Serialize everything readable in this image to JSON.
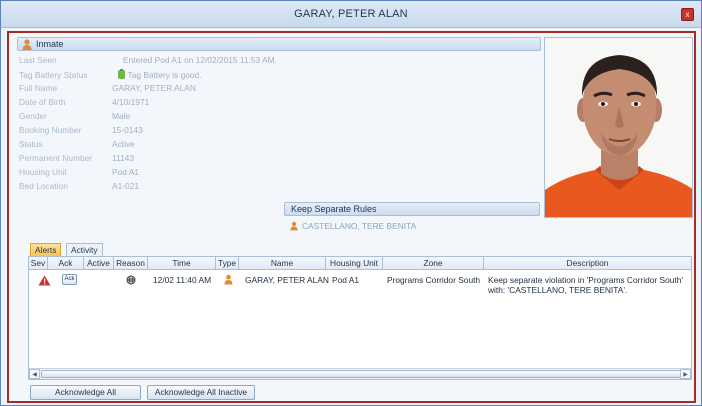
{
  "window": {
    "title": "GARAY, PETER ALAN",
    "close_glyph": "x"
  },
  "inmate": {
    "header": "Inmate",
    "fields": [
      {
        "label": "Last Seen",
        "value": "Entered Pod A1 on 12/02/2015 11:53 AM."
      },
      {
        "label": "Tag Battery Status",
        "value": "Tag Battery is good."
      },
      {
        "label": "Full Name",
        "value": "GARAY, PETER ALAN"
      },
      {
        "label": "Date of Birth",
        "value": "4/10/1971"
      },
      {
        "label": "Gender",
        "value": "Male"
      },
      {
        "label": "Booking Number",
        "value": "15-0143"
      },
      {
        "label": "Status",
        "value": "Active"
      },
      {
        "label": "Permanent Number",
        "value": "11143"
      },
      {
        "label": "Housing Unit",
        "value": "Pod A1"
      },
      {
        "label": "Bed Location",
        "value": "A1-021"
      }
    ]
  },
  "keep_separate": {
    "header": "Keep Separate Rules",
    "entry": "CASTELLANO, TERE BENITA"
  },
  "tabs": [
    {
      "label": "Alerts",
      "active": true
    },
    {
      "label": "Activity",
      "active": false
    }
  ],
  "grid": {
    "columns": [
      "Sev",
      "Ack",
      "Active",
      "Reason",
      "Time",
      "Type",
      "Name",
      "Housing Unit",
      "Zone",
      "Description"
    ],
    "rows": [
      {
        "ack_label": "Ack",
        "time": "12/02 11:40 AM",
        "name": "GARAY, PETER ALAN",
        "housing_unit": "Pod A1",
        "zone": "Programs Corridor South",
        "description_line1": "Keep separate violation in 'Programs Corridor South'",
        "description_line2": "with: 'CASTELLANO, TERE BENITA'."
      }
    ]
  },
  "buttons": {
    "ack_all": "Acknowledge All",
    "ack_all_inactive": "Acknowledge All Inactive"
  },
  "colors": {
    "frame_border": "#a52a2a",
    "active_tab": "#f6c24a",
    "severity_icon": "#c8312c",
    "person_icon": "#e3892e",
    "battery_icon": "#6cbf3b"
  }
}
